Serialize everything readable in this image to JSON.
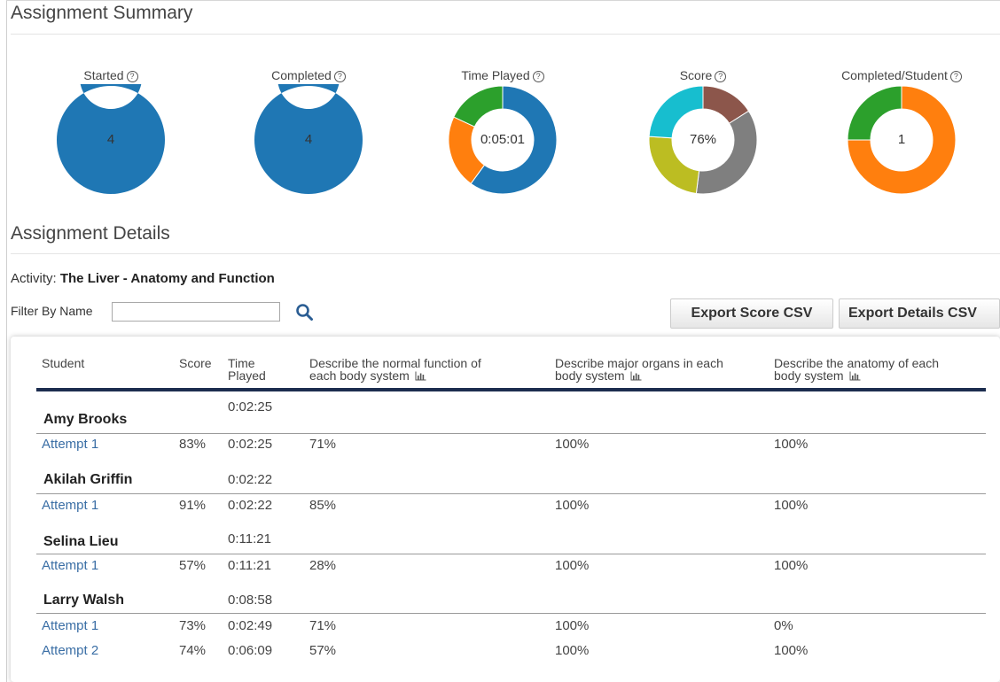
{
  "summary": {
    "title": "Assignment Summary",
    "charts": [
      {
        "label": "Started",
        "center": "4",
        "segments": [
          {
            "value": 1,
            "color": "#1f77b4"
          }
        ]
      },
      {
        "label": "Completed",
        "center": "4",
        "segments": [
          {
            "value": 1,
            "color": "#1f77b4"
          }
        ]
      },
      {
        "label": "Time Played",
        "center": "0:05:01",
        "segments": [
          {
            "value": 0.6,
            "color": "#1f77b4"
          },
          {
            "value": 0.22,
            "color": "#ff7f0e"
          },
          {
            "value": 0.18,
            "color": "#2ca02c"
          }
        ]
      },
      {
        "label": "Score",
        "center": "76%",
        "segments": [
          {
            "value": 0.16,
            "color": "#8c564b"
          },
          {
            "value": 0.36,
            "color": "#7f7f7f"
          },
          {
            "value": 0.24,
            "color": "#bcbd22"
          },
          {
            "value": 0.24,
            "color": "#17becf"
          }
        ]
      },
      {
        "label": "Completed/Student",
        "center": "1",
        "segments": [
          {
            "value": 0.75,
            "color": "#ff7f0e"
          },
          {
            "value": 0.25,
            "color": "#2ca02c"
          }
        ]
      }
    ]
  },
  "details": {
    "title": "Assignment Details",
    "activity_label": "Activity:",
    "activity_name": "The Liver - Anatomy and Function",
    "filter_label": "Filter By Name",
    "filter_value": "",
    "export_score_label": "Export Score CSV",
    "export_details_label": "Export Details CSV",
    "columns": {
      "student": "Student",
      "score": "Score",
      "time_line1": "Time",
      "time_line2": "Played",
      "q1_line1": "Describe the normal function of",
      "q1_line2": "each body system",
      "q2_line1": "Describe major organs in each",
      "q2_line2": "body system",
      "q3_line1": "Describe the anatomy of each",
      "q3_line2": "body system"
    },
    "students": [
      {
        "name": "Amy Brooks",
        "time": "0:02:25",
        "attempts": [
          {
            "label": "Attempt 1",
            "score": "83%",
            "time": "0:02:25",
            "q1": "71%",
            "q2": "100%",
            "q3": "100%"
          }
        ]
      },
      {
        "name": "Akilah Griffin",
        "time": "0:02:22",
        "attempts": [
          {
            "label": "Attempt 1",
            "score": "91%",
            "time": "0:02:22",
            "q1": "85%",
            "q2": "100%",
            "q3": "100%"
          }
        ]
      },
      {
        "name": "Selina Lieu",
        "time": "0:11:21",
        "attempts": [
          {
            "label": "Attempt 1",
            "score": "57%",
            "time": "0:11:21",
            "q1": "28%",
            "q2": "100%",
            "q3": "100%"
          }
        ]
      },
      {
        "name": "Larry Walsh",
        "time": "0:08:58",
        "attempts": [
          {
            "label": "Attempt 1",
            "score": "73%",
            "time": "0:02:49",
            "q1": "71%",
            "q2": "100%",
            "q3": "0%"
          },
          {
            "label": "Attempt 2",
            "score": "74%",
            "time": "0:06:09",
            "q1": "57%",
            "q2": "100%",
            "q3": "100%"
          }
        ]
      }
    ]
  }
}
